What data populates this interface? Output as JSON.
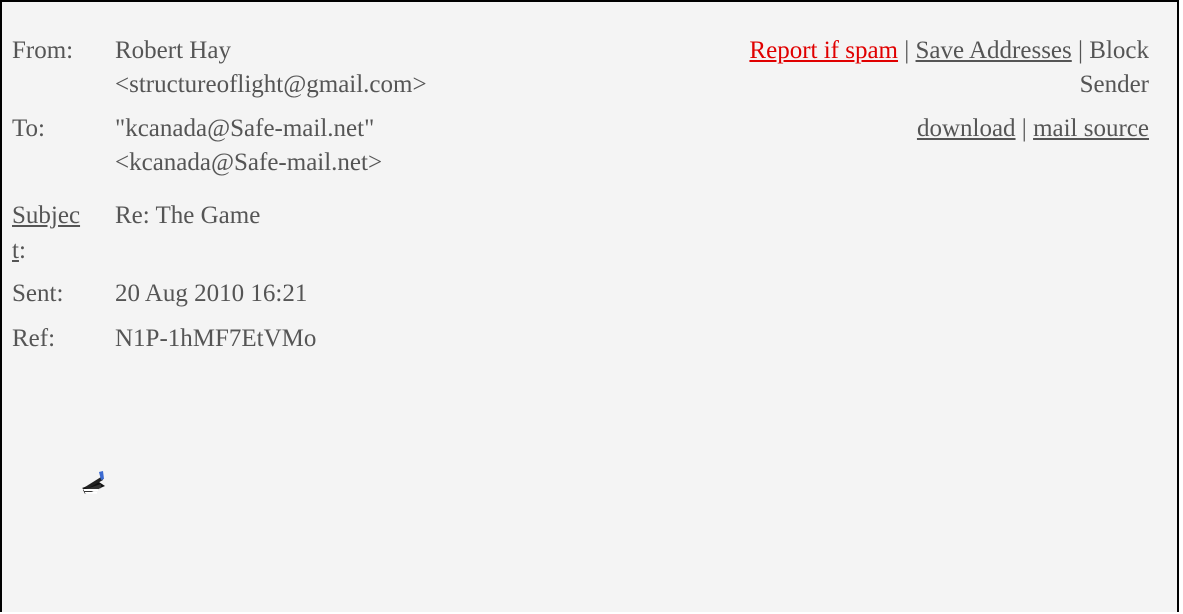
{
  "header": {
    "from_label": "From:",
    "from_name": "Robert Hay",
    "from_email": "<structureoflight@gmail.com>",
    "to_label": "To:",
    "to_name": "\"kcanada@Safe-mail.net\"",
    "to_email": "<kcanada@Safe-mail.net>",
    "subject_label_part1": "Subjec",
    "subject_label_part2": "t",
    "subject_label_colon": ":",
    "subject_value": "Re: The Game",
    "sent_label": "Sent:",
    "sent_value": "20 Aug 2010 16:21",
    "ref_label": "Ref:",
    "ref_value": "N1P-1hMF7EtVMo"
  },
  "actions": {
    "report_spam": "Report if spam",
    "save_addresses": "Save Addresses",
    "block": "Block",
    "sender": "Sender",
    "download": "download",
    "mail_source": "mail source",
    "separator": "|"
  },
  "colors": {
    "text": "#555555",
    "spam_link": "#e00000",
    "background": "#f4f4f4"
  },
  "icons": {
    "compose": "compose-pen-icon"
  }
}
